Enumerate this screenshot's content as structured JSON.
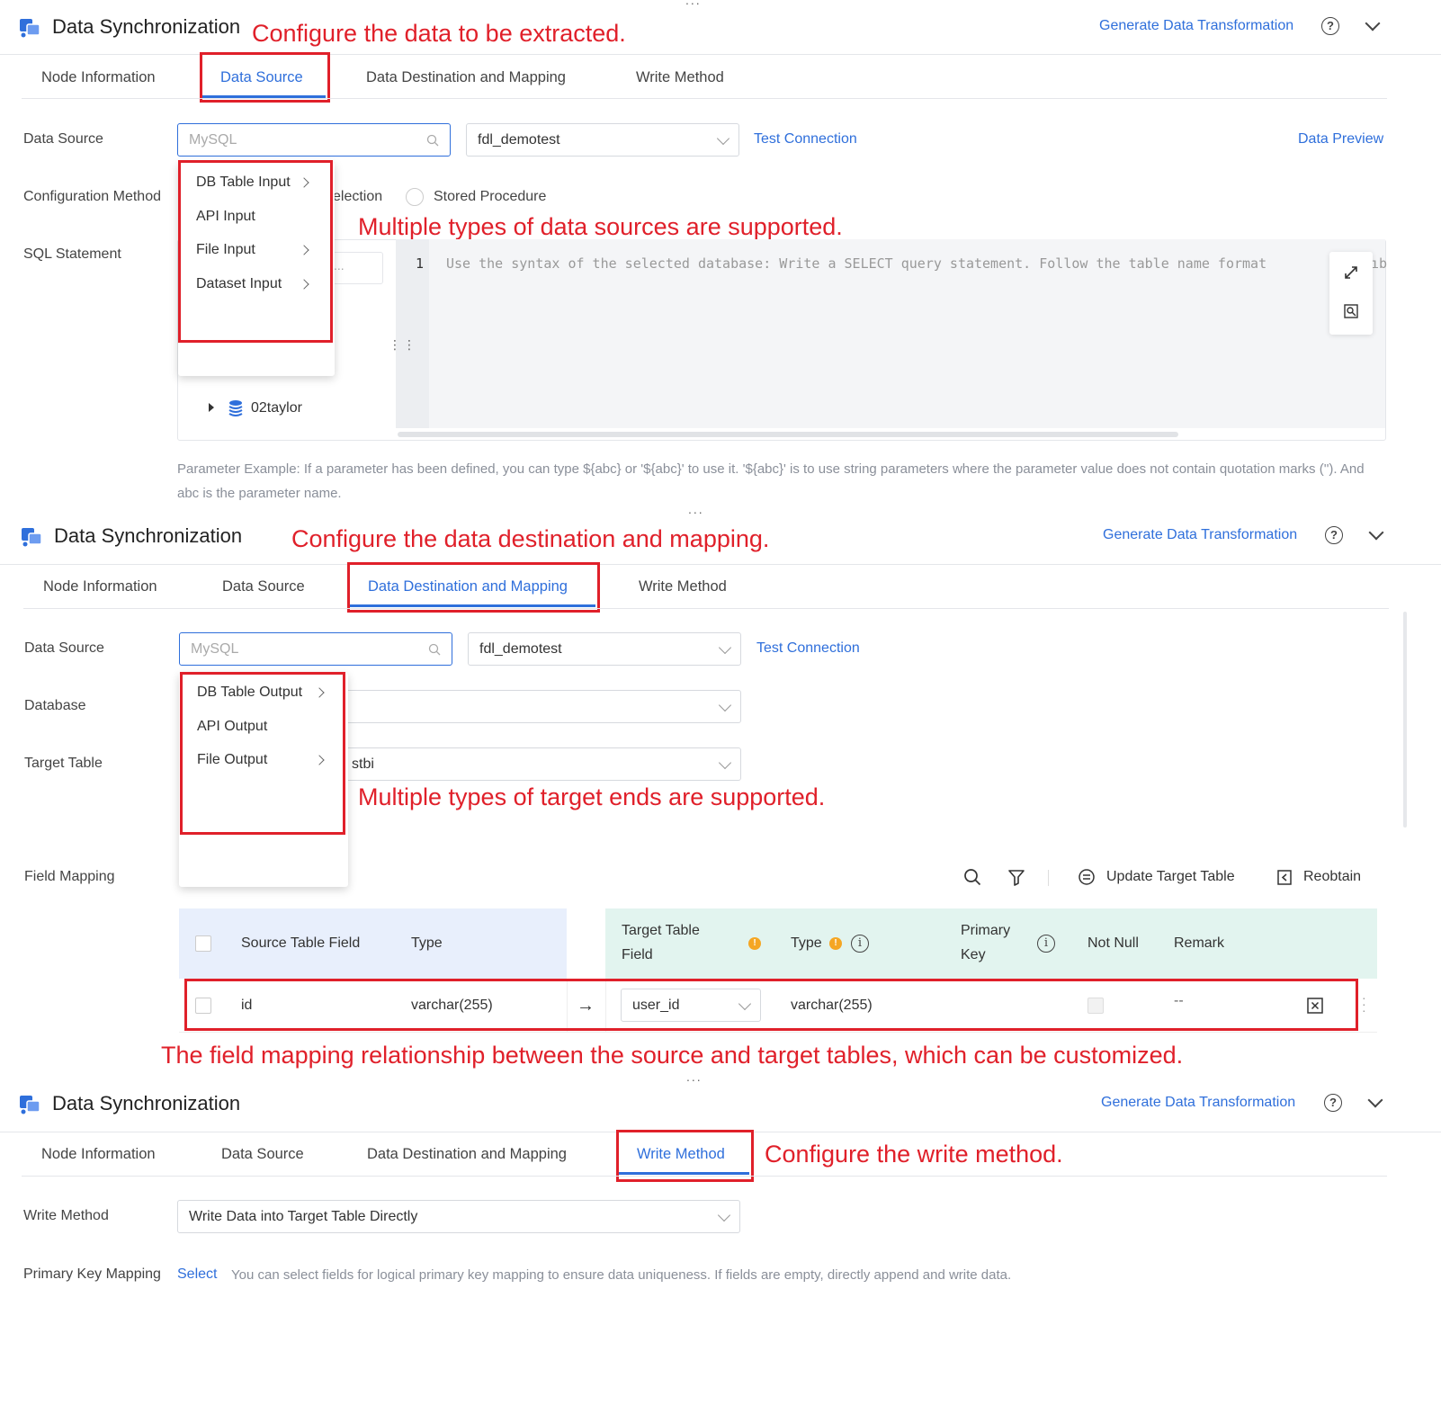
{
  "common": {
    "title": "Data Synchronization",
    "generate_link": "Generate Data Transformation",
    "help_icon": "?",
    "tabs": [
      "Node Information",
      "Data Source",
      "Data Destination and Mapping",
      "Write Method"
    ],
    "dots": "..."
  },
  "colors": {
    "accent": "#2f6fdb",
    "annotation": "#e0202a"
  },
  "panel1": {
    "annotation_top": "Configure the data to be extracted.",
    "annotation_mid": "Multiple types of data sources are supported.",
    "data_source_label": "Data Source",
    "search_placeholder": "MySQL",
    "connection_value": "fdl_demotest",
    "test_connection": "Test Connection",
    "data_preview": "Data Preview",
    "config_method_label": "Configuration Method",
    "radio_partial": "election",
    "stored_procedure": "Stored Procedure",
    "sql_label": "SQL Statement",
    "menu": [
      "DB Table Input",
      "API Input",
      "File Input",
      "Dataset Input"
    ],
    "line_no": "1",
    "sql_placeholder": "Use the syntax of the selected database: Write a SELECT query statement. Follow the table name format",
    "sql_partial_right": "ıb",
    "tree_item": "02taylor",
    "ellipsis": "...",
    "param_note": "Parameter Example: If a parameter has been defined, you can type ${abc} or '${abc}' to use it. '${abc}' is to use string parameters where the parameter value does not contain quotation marks ('').  And abc is the parameter name."
  },
  "panel2": {
    "annotation_top": "Configure the data destination and mapping.",
    "annotation_mid": "Multiple types of target ends are supported.",
    "annotation_bottom": "The field mapping relationship between the source and target tables, which can be customized.",
    "data_source_label": "Data Source",
    "search_placeholder": "MySQL",
    "connection_value": "fdl_demotest",
    "test_connection": "Test Connection",
    "database_label": "Database",
    "target_table_label": "Target Table",
    "target_table_partial": "stbi",
    "menu": [
      "DB Table Output",
      "API Output",
      "File Output"
    ],
    "field_mapping_label": "Field Mapping",
    "update_target_table": "Update Target Table",
    "reobtain": "Reobtain",
    "headers": {
      "source_field": "Source Table Field",
      "source_type": "Type",
      "target_field_line1": "Target Table",
      "target_field_line2": "Field",
      "target_type": "Type",
      "primary_key_line1": "Primary",
      "primary_key_line2": "Key",
      "not_null": "Not Null",
      "remark": "Remark"
    },
    "row": {
      "source_field": "id",
      "source_type": "varchar(255)",
      "arrow": "→",
      "target_field": "user_id",
      "target_type": "varchar(255)",
      "remark": "--"
    }
  },
  "panel3": {
    "annotation": "Configure the write method.",
    "write_method_label": "Write Method",
    "write_method_value": "Write Data into Target Table Directly",
    "pk_label": "Primary Key Mapping",
    "pk_select": "Select",
    "pk_note": "You can select fields for logical primary key mapping to ensure data uniqueness. If fields are empty, directly append and write data."
  }
}
